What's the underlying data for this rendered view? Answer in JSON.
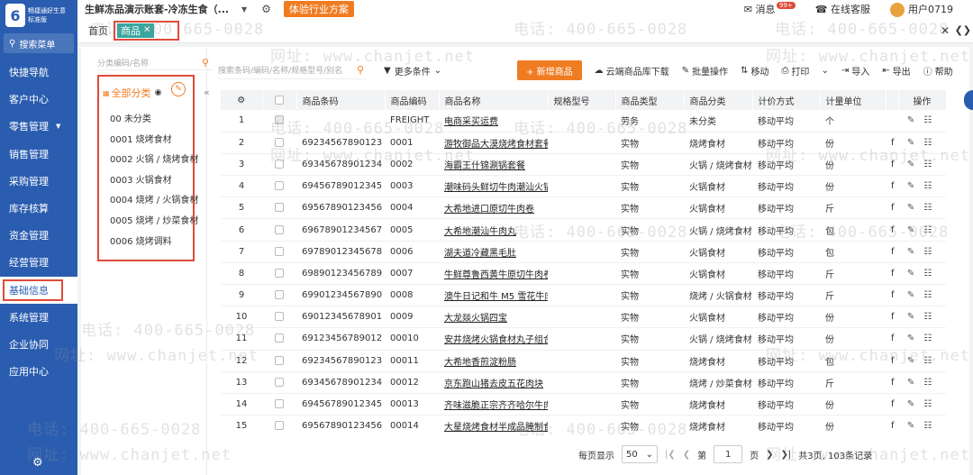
{
  "sidebar": {
    "logo_char": "6",
    "logo_line1": "畅捷通好生意",
    "logo_line2": "标准版",
    "search_label": "搜索菜单",
    "items": [
      {
        "label": "快捷导航",
        "active": false
      },
      {
        "label": "客户中心",
        "active": false
      },
      {
        "label": "零售管理",
        "active": false,
        "caret": "▼"
      },
      {
        "label": "销售管理",
        "active": false
      },
      {
        "label": "采购管理",
        "active": false
      },
      {
        "label": "库存核算",
        "active": false
      },
      {
        "label": "资金管理",
        "active": false
      },
      {
        "label": "经营管理",
        "active": false
      },
      {
        "label": "基础信息",
        "active": true
      },
      {
        "label": "系统管理",
        "active": false
      },
      {
        "label": "企业协同",
        "active": false
      },
      {
        "label": "应用中心",
        "active": false
      }
    ]
  },
  "header": {
    "account_title": "生鲜冻品演示账套-冷冻生食（...",
    "trial_button": "体验行业方案",
    "messages_label": "消息",
    "messages_badge": "99+",
    "service_label": "在线客服",
    "user_label": "用户0719"
  },
  "tabs": {
    "home": "首页",
    "active": "商品"
  },
  "tree": {
    "search_placeholder": "分类编码/名称",
    "root_label": "全部分类",
    "items": [
      "00 未分类",
      "0001 烧烤食材",
      "0002 火锅 / 烧烤食材",
      "0003 火锅食材",
      "0004 烧烤 / 火锅食材",
      "0005 烧烤 / 炒菜食材",
      "0006 烧烤调料"
    ]
  },
  "toolbar": {
    "search_placeholder": "搜索条码/编码/名称/规格型号/别名",
    "more_filter": "更多条件",
    "new_button": "+ 新增商品",
    "cloud_download": "云端商品库下载",
    "batch_ops": "批量操作",
    "move": "移动",
    "print": "打印",
    "import": "导入",
    "export": "导出",
    "help": "帮助"
  },
  "table": {
    "headers": [
      "",
      "",
      "商品条码",
      "商品编码",
      "商品名称",
      "规格型号",
      "商品类型",
      "商品分类",
      "计价方式",
      "计量单位",
      "",
      "操作"
    ],
    "rows": [
      {
        "no": "1",
        "barcode": "",
        "code": "FREIGHT",
        "name": "电商采买运费",
        "spec": "",
        "type": "劳务",
        "category": "未分类",
        "pricing": "移动平均",
        "unit": "个",
        "extra": ""
      },
      {
        "no": "2",
        "barcode": "69234567890123",
        "code": "0001",
        "name": "游牧御品大漠烧烤食材套餐",
        "spec": "",
        "type": "实物",
        "category": "烧烤食材",
        "pricing": "移动平均",
        "unit": "份",
        "extra": "f"
      },
      {
        "no": "3",
        "barcode": "69345678901234",
        "code": "0002",
        "name": "海霸王什锦涮锅套餐",
        "spec": "",
        "type": "实物",
        "category": "火锅 / 烧烤食材",
        "pricing": "移动平均",
        "unit": "份",
        "extra": "f"
      },
      {
        "no": "4",
        "barcode": "69456789012345",
        "code": "0003",
        "name": "潮味码头鲜切牛肉潮汕火锅",
        "spec": "",
        "type": "实物",
        "category": "火锅食材",
        "pricing": "移动平均",
        "unit": "份",
        "extra": "f"
      },
      {
        "no": "5",
        "barcode": "69567890123456",
        "code": "0004",
        "name": "大希地进口原切牛肉卷",
        "spec": "",
        "type": "实物",
        "category": "火锅食材",
        "pricing": "移动平均",
        "unit": "斤",
        "extra": "f"
      },
      {
        "no": "6",
        "barcode": "69678901234567",
        "code": "0005",
        "name": "大希地潮汕牛肉丸",
        "spec": "",
        "type": "实物",
        "category": "火锅 / 烧烤食材",
        "pricing": "移动平均",
        "unit": "包",
        "extra": "f"
      },
      {
        "no": "7",
        "barcode": "69789012345678",
        "code": "0006",
        "name": "湖夫道冷藏黑毛肚",
        "spec": "",
        "type": "实物",
        "category": "火锅食材",
        "pricing": "移动平均",
        "unit": "包",
        "extra": "f"
      },
      {
        "no": "8",
        "barcode": "69890123456789",
        "code": "0007",
        "name": "牛鲜尊鲁西黄牛原切牛肉卷",
        "spec": "",
        "type": "实物",
        "category": "火锅食材",
        "pricing": "移动平均",
        "unit": "斤",
        "extra": "f"
      },
      {
        "no": "9",
        "barcode": "69901234567890",
        "code": "0008",
        "name": "澳牛日记和牛 M5 雪花牛肉",
        "spec": "",
        "type": "实物",
        "category": "烧烤 / 火锅食材",
        "pricing": "移动平均",
        "unit": "斤",
        "extra": "f"
      },
      {
        "no": "10",
        "barcode": "69012345678901",
        "code": "0009",
        "name": "大龙燚火锅四宝",
        "spec": "",
        "type": "实物",
        "category": "火锅食材",
        "pricing": "移动平均",
        "unit": "份",
        "extra": "f"
      },
      {
        "no": "11",
        "barcode": "69123456789012",
        "code": "00010",
        "name": "安井烧烤火锅食材丸子组合",
        "spec": "",
        "type": "实物",
        "category": "火锅 / 烧烤食材",
        "pricing": "移动平均",
        "unit": "份",
        "extra": "f"
      },
      {
        "no": "12",
        "barcode": "69234567890123",
        "code": "00011",
        "name": "大希地香煎淀粉肠",
        "spec": "",
        "type": "实物",
        "category": "烧烤食材",
        "pricing": "移动平均",
        "unit": "包",
        "extra": "f"
      },
      {
        "no": "13",
        "barcode": "69345678901234",
        "code": "00012",
        "name": "京东跑山猪去皮五花肉块",
        "spec": "",
        "type": "实物",
        "category": "烧烤 / 炒菜食材",
        "pricing": "移动平均",
        "unit": "斤",
        "extra": "f"
      },
      {
        "no": "14",
        "barcode": "69456789012345",
        "code": "00013",
        "name": "齐味滋脆正宗齐齐哈尔牛肉",
        "spec": "",
        "type": "实物",
        "category": "烧烤食材",
        "pricing": "移动平均",
        "unit": "份",
        "extra": "f"
      },
      {
        "no": "15",
        "barcode": "69567890123456",
        "code": "00014",
        "name": "大星烧烤食材半成品腌制食",
        "spec": "",
        "type": "实物",
        "category": "烧烤食材",
        "pricing": "移动平均",
        "unit": "份",
        "extra": "f"
      }
    ]
  },
  "pager": {
    "per_page_label": "每页显示",
    "per_page": "50",
    "page_prefix": "第",
    "page": "1",
    "page_suffix": "页",
    "summary": "共3页, 103条记录"
  },
  "watermark": {
    "phone": "电话: 400-665-0028",
    "site": "网址: www.chanjet.net"
  },
  "colors": {
    "sidebar_bg": "#2a5db0",
    "accent_orange": "#f07c22",
    "tab_teal": "#3aa6a0",
    "highlight_red": "#e04a3a"
  }
}
